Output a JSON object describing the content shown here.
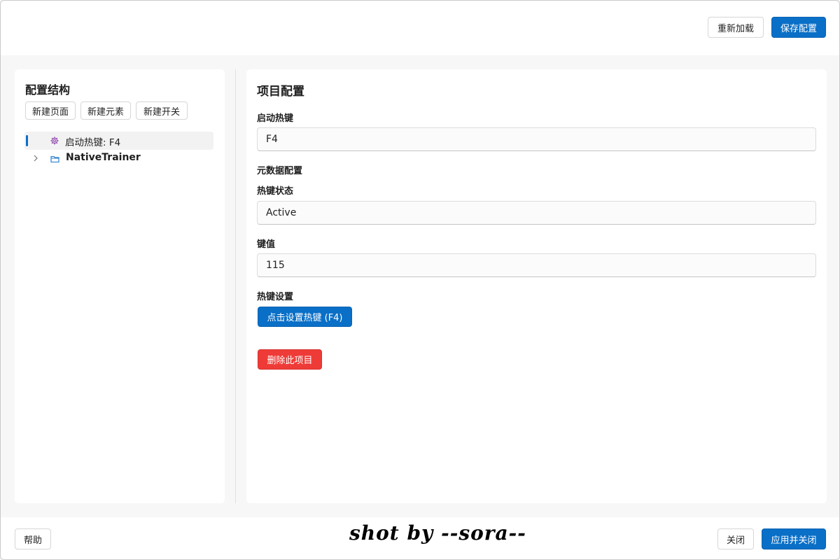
{
  "toolbar": {
    "reload_label": "重新加载",
    "save_label": "保存配置"
  },
  "sidebar": {
    "title": "配置结构",
    "buttons": [
      "新建页面",
      "新建元素",
      "新建开关"
    ],
    "tree": [
      {
        "label": "启动热键: F4",
        "icon": "gear-icon",
        "selected": true
      },
      {
        "label": "NativeTrainer",
        "icon": "folder-icon",
        "expandable": true
      }
    ]
  },
  "main": {
    "title": "项目配置",
    "hotkey_label": "启动热键",
    "hotkey_value": "F4",
    "metadata_label": "元数据配置",
    "status_label": "热键状态",
    "status_value": "Active",
    "keyvalue_label": "键值",
    "keyvalue_value": "115",
    "hotkey_settings_label": "热键设置",
    "set_hotkey_button": "点击设置热键 (F4)",
    "delete_button": "删除此项目"
  },
  "footer": {
    "help_label": "帮助",
    "close_label": "关闭",
    "apply_close_label": "应用并关闭",
    "watermark": "shot by --sora--"
  },
  "colors": {
    "primary": "#0a6fc7",
    "danger": "#ef3b37",
    "icon_purple": "#8e44ad",
    "icon_blue": "#1e78c8"
  }
}
